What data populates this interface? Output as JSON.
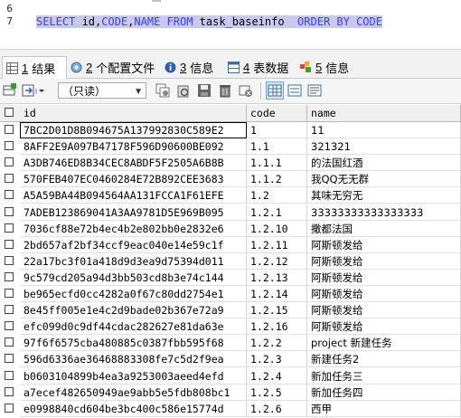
{
  "editor": {
    "line_numbers": [
      "6",
      "7"
    ],
    "sql": {
      "kw_select": "SELECT",
      "cols": " id,",
      "kw_code": "CODE",
      "comma": ",",
      "kw_name": "NAME",
      "kw_from": " FROM",
      "table": " task_baseinfo",
      "kw_order": "  ORDER BY",
      "kw_code2": " CODE"
    }
  },
  "tabs": [
    {
      "num": "1",
      "label": "结果"
    },
    {
      "num": "2",
      "label": "个配置文件"
    },
    {
      "num": "3",
      "label": "信息"
    },
    {
      "num": "4",
      "label": "表数据"
    },
    {
      "num": "5",
      "label": "信息"
    }
  ],
  "toolbar": {
    "filter_value": "（只读）"
  },
  "grid": {
    "columns": [
      "id",
      "code",
      "name"
    ],
    "rows": [
      [
        "7BC2D01D8B094675A137992830C589E2",
        "1",
        "11"
      ],
      [
        "8AFF2E9A097B47178F596D90600BE092",
        "1.1",
        "321321"
      ],
      [
        "A3DB746ED8B34CEC8ABDF5F2505A6B8B",
        "1.1.1",
        "的法国红酒"
      ],
      [
        "570FEB407EC0460284E72B892CEE3683",
        "1.1.2",
        "我QQ无无群"
      ],
      [
        "A5A59BA44B094564AA131FCCA1F61EFE",
        "1.2",
        "其味无穷无"
      ],
      [
        "7ADEB123869041A3AA9781D5E969B095",
        "1.2.1",
        "33333333333333333"
      ],
      [
        "7036cf88e72b4ec4b2e802bb0e2832e6",
        "1.2.10",
        "撒都法国"
      ],
      [
        "2bd657af2bf34ccf9eac040e14e59c1f",
        "1.2.11",
        "阿斯顿发给"
      ],
      [
        "22a17bc3f01a418d9d3ea9d75394d011",
        "1.2.12",
        "阿斯顿发给"
      ],
      [
        "9c579cd205a94d3bb503cd8b3e74c144",
        "1.2.13",
        "阿斯顿发给"
      ],
      [
        "be965ecfd0cc4282a0f67c80dd2754e1",
        "1.2.14",
        "阿斯顿发给"
      ],
      [
        "8e45ff005e1e4c2d9bade02b367e72a9",
        "1.2.15",
        "阿斯顿发给"
      ],
      [
        "efc099d0c9df44cdac282627e81da63e",
        "1.2.16",
        "阿斯顿发给"
      ],
      [
        "97f6f6575cba480885c0387fbb595f68",
        "1.2.2",
        "project 新建任务"
      ],
      [
        "596d6336ae36468883308fe7c5d2f9ea",
        "1.2.3",
        "新建任务2"
      ],
      [
        "b0603104899b4ea3a9253003aeed4efd",
        "1.2.4",
        "新加任务三"
      ],
      [
        "a7ecef482650949ae9abb5e5fdb808bc1",
        "1.2.5",
        "新加任务四"
      ],
      [
        "e0998840cd604be3bc400c586e15774d",
        "1.2.6",
        "西甲"
      ]
    ]
  }
}
